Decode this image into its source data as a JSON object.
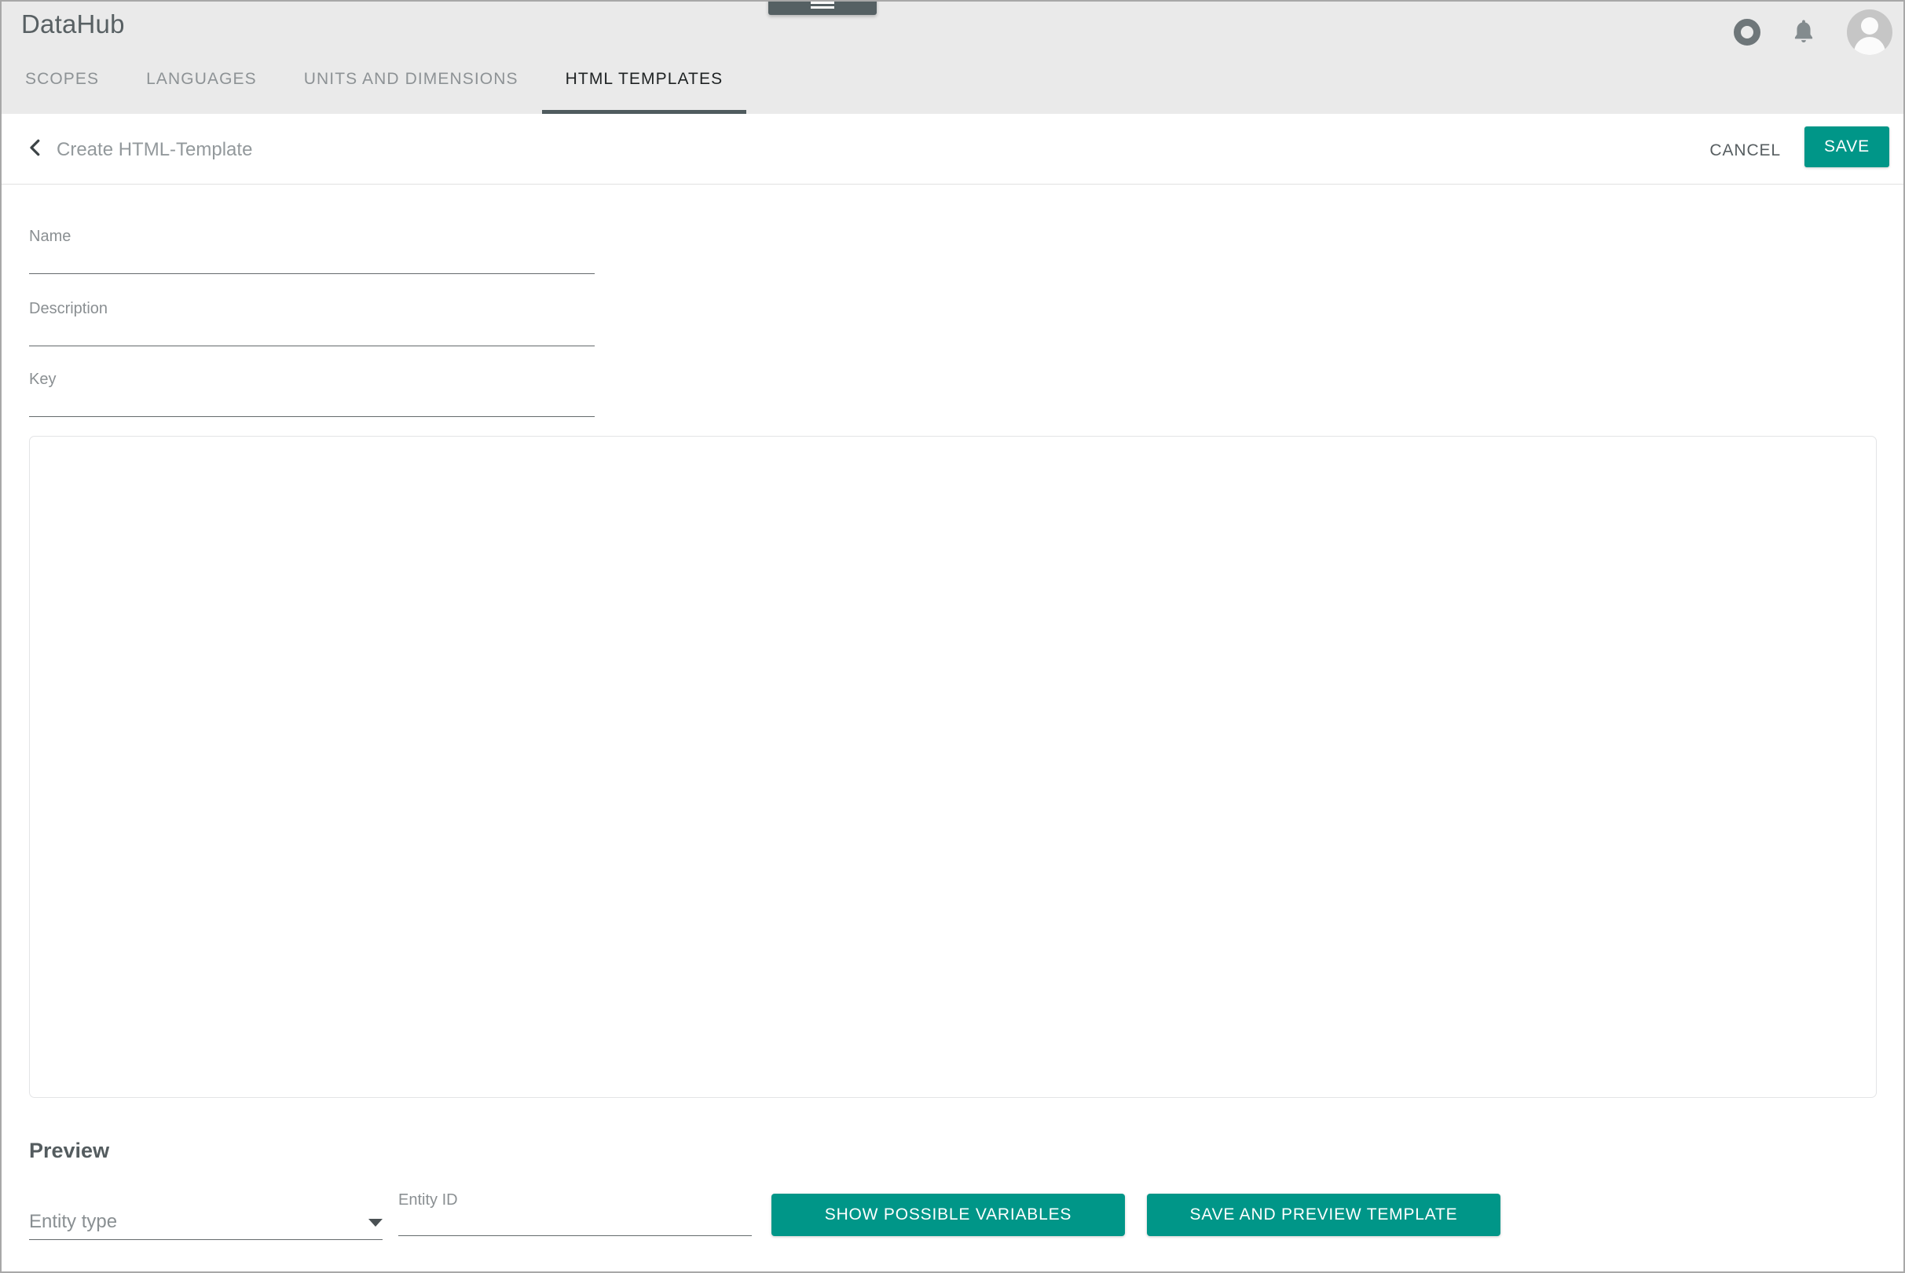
{
  "app": {
    "title": "DataHub",
    "menu_handle_icon": "hamburger-menu-icon",
    "header_icons": [
      {
        "name": "record-ring-icon",
        "glyph": "○"
      },
      {
        "name": "notifications-bell-icon",
        "glyph": "🔔"
      },
      {
        "name": "user-avatar",
        "glyph": ""
      }
    ]
  },
  "tabs": [
    {
      "label": "SCOPES",
      "active": false
    },
    {
      "label": "LANGUAGES",
      "active": false
    },
    {
      "label": "UNITS AND DIMENSIONS",
      "active": false
    },
    {
      "label": "HTML TEMPLATES",
      "active": true
    }
  ],
  "action_bar": {
    "back_icon": "chevron-left-icon",
    "title": "Create HTML-Template",
    "cancel_label": "CANCEL",
    "save_label": "SAVE"
  },
  "form": {
    "fields": [
      {
        "label": "Name",
        "value": "",
        "placeholder": ""
      },
      {
        "label": "Description",
        "value": "",
        "placeholder": ""
      },
      {
        "label": "Key",
        "value": "",
        "placeholder": ""
      }
    ],
    "editor": {
      "value": "",
      "placeholder": ""
    }
  },
  "preview": {
    "title": "Preview",
    "entity_type": {
      "label": "Entity type",
      "selected": "Entity type",
      "caret_icon": "chevron-down-icon",
      "options": []
    },
    "entity_id": {
      "label": "Entity ID",
      "value": "",
      "placeholder": ""
    },
    "show_variables_label": "SHOW POSSIBLE VARIABLES",
    "save_preview_label": "SAVE AND PREVIEW TEMPLATE"
  },
  "colors": {
    "accent": "#009688",
    "header_bg": "#eaeaea",
    "active_tab_underline": "#4f5b5e",
    "text_muted": "#8a8f92"
  }
}
